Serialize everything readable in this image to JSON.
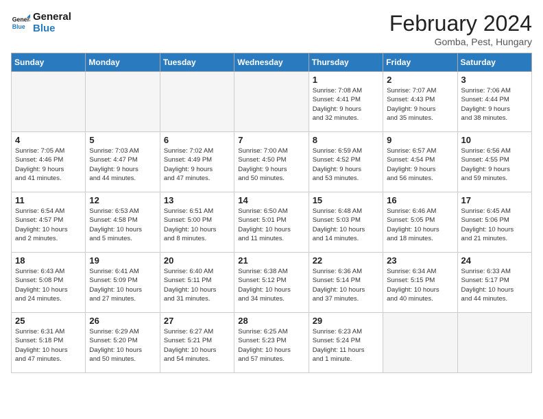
{
  "header": {
    "logo_line1": "General",
    "logo_line2": "Blue",
    "month_title": "February 2024",
    "location": "Gomba, Pest, Hungary"
  },
  "weekdays": [
    "Sunday",
    "Monday",
    "Tuesday",
    "Wednesday",
    "Thursday",
    "Friday",
    "Saturday"
  ],
  "weeks": [
    [
      {
        "day": "",
        "info": ""
      },
      {
        "day": "",
        "info": ""
      },
      {
        "day": "",
        "info": ""
      },
      {
        "day": "",
        "info": ""
      },
      {
        "day": "1",
        "info": "Sunrise: 7:08 AM\nSunset: 4:41 PM\nDaylight: 9 hours\nand 32 minutes."
      },
      {
        "day": "2",
        "info": "Sunrise: 7:07 AM\nSunset: 4:43 PM\nDaylight: 9 hours\nand 35 minutes."
      },
      {
        "day": "3",
        "info": "Sunrise: 7:06 AM\nSunset: 4:44 PM\nDaylight: 9 hours\nand 38 minutes."
      }
    ],
    [
      {
        "day": "4",
        "info": "Sunrise: 7:05 AM\nSunset: 4:46 PM\nDaylight: 9 hours\nand 41 minutes."
      },
      {
        "day": "5",
        "info": "Sunrise: 7:03 AM\nSunset: 4:47 PM\nDaylight: 9 hours\nand 44 minutes."
      },
      {
        "day": "6",
        "info": "Sunrise: 7:02 AM\nSunset: 4:49 PM\nDaylight: 9 hours\nand 47 minutes."
      },
      {
        "day": "7",
        "info": "Sunrise: 7:00 AM\nSunset: 4:50 PM\nDaylight: 9 hours\nand 50 minutes."
      },
      {
        "day": "8",
        "info": "Sunrise: 6:59 AM\nSunset: 4:52 PM\nDaylight: 9 hours\nand 53 minutes."
      },
      {
        "day": "9",
        "info": "Sunrise: 6:57 AM\nSunset: 4:54 PM\nDaylight: 9 hours\nand 56 minutes."
      },
      {
        "day": "10",
        "info": "Sunrise: 6:56 AM\nSunset: 4:55 PM\nDaylight: 9 hours\nand 59 minutes."
      }
    ],
    [
      {
        "day": "11",
        "info": "Sunrise: 6:54 AM\nSunset: 4:57 PM\nDaylight: 10 hours\nand 2 minutes."
      },
      {
        "day": "12",
        "info": "Sunrise: 6:53 AM\nSunset: 4:58 PM\nDaylight: 10 hours\nand 5 minutes."
      },
      {
        "day": "13",
        "info": "Sunrise: 6:51 AM\nSunset: 5:00 PM\nDaylight: 10 hours\nand 8 minutes."
      },
      {
        "day": "14",
        "info": "Sunrise: 6:50 AM\nSunset: 5:01 PM\nDaylight: 10 hours\nand 11 minutes."
      },
      {
        "day": "15",
        "info": "Sunrise: 6:48 AM\nSunset: 5:03 PM\nDaylight: 10 hours\nand 14 minutes."
      },
      {
        "day": "16",
        "info": "Sunrise: 6:46 AM\nSunset: 5:05 PM\nDaylight: 10 hours\nand 18 minutes."
      },
      {
        "day": "17",
        "info": "Sunrise: 6:45 AM\nSunset: 5:06 PM\nDaylight: 10 hours\nand 21 minutes."
      }
    ],
    [
      {
        "day": "18",
        "info": "Sunrise: 6:43 AM\nSunset: 5:08 PM\nDaylight: 10 hours\nand 24 minutes."
      },
      {
        "day": "19",
        "info": "Sunrise: 6:41 AM\nSunset: 5:09 PM\nDaylight: 10 hours\nand 27 minutes."
      },
      {
        "day": "20",
        "info": "Sunrise: 6:40 AM\nSunset: 5:11 PM\nDaylight: 10 hours\nand 31 minutes."
      },
      {
        "day": "21",
        "info": "Sunrise: 6:38 AM\nSunset: 5:12 PM\nDaylight: 10 hours\nand 34 minutes."
      },
      {
        "day": "22",
        "info": "Sunrise: 6:36 AM\nSunset: 5:14 PM\nDaylight: 10 hours\nand 37 minutes."
      },
      {
        "day": "23",
        "info": "Sunrise: 6:34 AM\nSunset: 5:15 PM\nDaylight: 10 hours\nand 40 minutes."
      },
      {
        "day": "24",
        "info": "Sunrise: 6:33 AM\nSunset: 5:17 PM\nDaylight: 10 hours\nand 44 minutes."
      }
    ],
    [
      {
        "day": "25",
        "info": "Sunrise: 6:31 AM\nSunset: 5:18 PM\nDaylight: 10 hours\nand 47 minutes."
      },
      {
        "day": "26",
        "info": "Sunrise: 6:29 AM\nSunset: 5:20 PM\nDaylight: 10 hours\nand 50 minutes."
      },
      {
        "day": "27",
        "info": "Sunrise: 6:27 AM\nSunset: 5:21 PM\nDaylight: 10 hours\nand 54 minutes."
      },
      {
        "day": "28",
        "info": "Sunrise: 6:25 AM\nSunset: 5:23 PM\nDaylight: 10 hours\nand 57 minutes."
      },
      {
        "day": "29",
        "info": "Sunrise: 6:23 AM\nSunset: 5:24 PM\nDaylight: 11 hours\nand 1 minute."
      },
      {
        "day": "",
        "info": ""
      },
      {
        "day": "",
        "info": ""
      }
    ]
  ]
}
